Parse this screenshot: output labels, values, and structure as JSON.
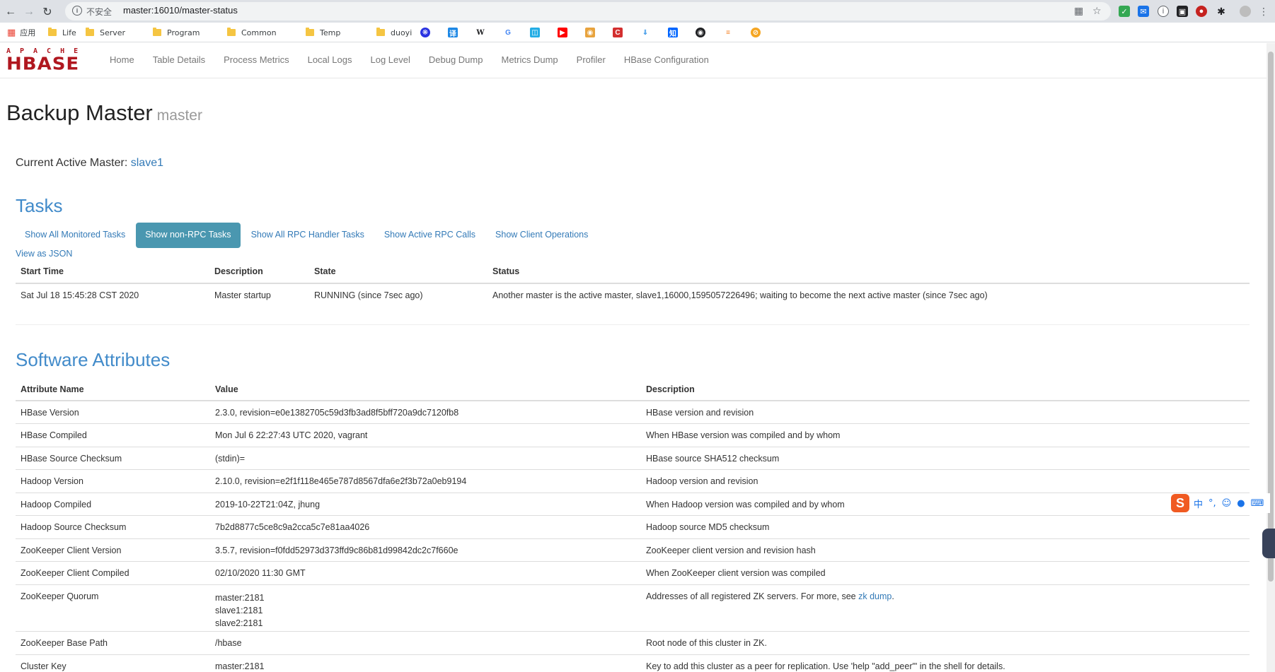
{
  "browser": {
    "security_label": "不安全",
    "url": "master:16010/master-status",
    "bookmarks": {
      "apps": "应用",
      "life": "Life",
      "server": "Server",
      "program": "Program",
      "common": "Common",
      "temp": "Temp",
      "duoyi": "duoyi"
    }
  },
  "logo": {
    "top": "APACHE",
    "main": "HBASE"
  },
  "nav": {
    "home": "Home",
    "table_details": "Table Details",
    "process_metrics": "Process Metrics",
    "local_logs": "Local Logs",
    "log_level": "Log Level",
    "debug_dump": "Debug Dump",
    "metrics_dump": "Metrics Dump",
    "profiler": "Profiler",
    "hbase_configuration": "HBase Configuration"
  },
  "header": {
    "title": "Backup Master",
    "subtitle": "master"
  },
  "active_master": {
    "label": "Current Active Master:",
    "value": "slave1"
  },
  "tasks": {
    "heading": "Tasks",
    "tabs": {
      "all_monitored": "Show All Monitored Tasks",
      "non_rpc": "Show non-RPC Tasks",
      "rpc_handler": "Show All RPC Handler Tasks",
      "active_rpc": "Show Active RPC Calls",
      "client_ops": "Show Client Operations"
    },
    "view_json": "View as JSON",
    "columns": {
      "start_time": "Start Time",
      "description": "Description",
      "state": "State",
      "status": "Status"
    },
    "rows": [
      {
        "start_time": "Sat Jul 18 15:45:28 CST 2020",
        "description": "Master startup",
        "state": "RUNNING (since 7sec ago)",
        "status": "Another master is the active master, slave1,16000,1595057226496; waiting to become the next active master (since 7sec ago)"
      }
    ]
  },
  "software": {
    "heading": "Software Attributes",
    "columns": {
      "name": "Attribute Name",
      "value": "Value",
      "description": "Description"
    },
    "rows": [
      {
        "name": "HBase Version",
        "value": "2.3.0, revision=e0e1382705c59d3fb3ad8f5bff720a9dc7120fb8",
        "description": "HBase version and revision"
      },
      {
        "name": "HBase Compiled",
        "value": "Mon Jul 6 22:27:43 UTC 2020, vagrant",
        "description": "When HBase version was compiled and by whom"
      },
      {
        "name": "HBase Source Checksum",
        "value": "(stdin)=",
        "description": "HBase source SHA512 checksum"
      },
      {
        "name": "Hadoop Version",
        "value": "2.10.0, revision=e2f1f118e465e787d8567dfa6e2f3b72a0eb9194",
        "description": "Hadoop version and revision"
      },
      {
        "name": "Hadoop Compiled",
        "value": "2019-10-22T21:04Z, jhung",
        "description": "When Hadoop version was compiled and by whom"
      },
      {
        "name": "Hadoop Source Checksum",
        "value": "7b2d8877c5ce8c9a2cca5c7e81aa4026",
        "description": "Hadoop source MD5 checksum"
      },
      {
        "name": "ZooKeeper Client Version",
        "value": "3.5.7, revision=f0fdd52973d373ffd9c86b81d99842dc2c7f660e",
        "description": "ZooKeeper client version and revision hash"
      },
      {
        "name": "ZooKeeper Client Compiled",
        "value": "02/10/2020 11:30 GMT",
        "description": "When ZooKeeper client version was compiled"
      },
      {
        "name": "ZooKeeper Quorum",
        "value_lines": [
          "master:2181",
          "slave1:2181",
          "slave2:2181"
        ],
        "description": "Addresses of all registered ZK servers. For more, see",
        "description_link": "zk dump",
        "description_end": "."
      },
      {
        "name": "ZooKeeper Base Path",
        "value": "/hbase",
        "description": "Root node of this cluster in ZK."
      },
      {
        "name": "Cluster Key",
        "value": "master:2181",
        "description": "Key to add this cluster as a peer for replication. Use 'help \"add_peer\"' in the shell for details."
      }
    ]
  },
  "ime": {
    "logo": "S",
    "mode": "中",
    "punct": "°,"
  }
}
